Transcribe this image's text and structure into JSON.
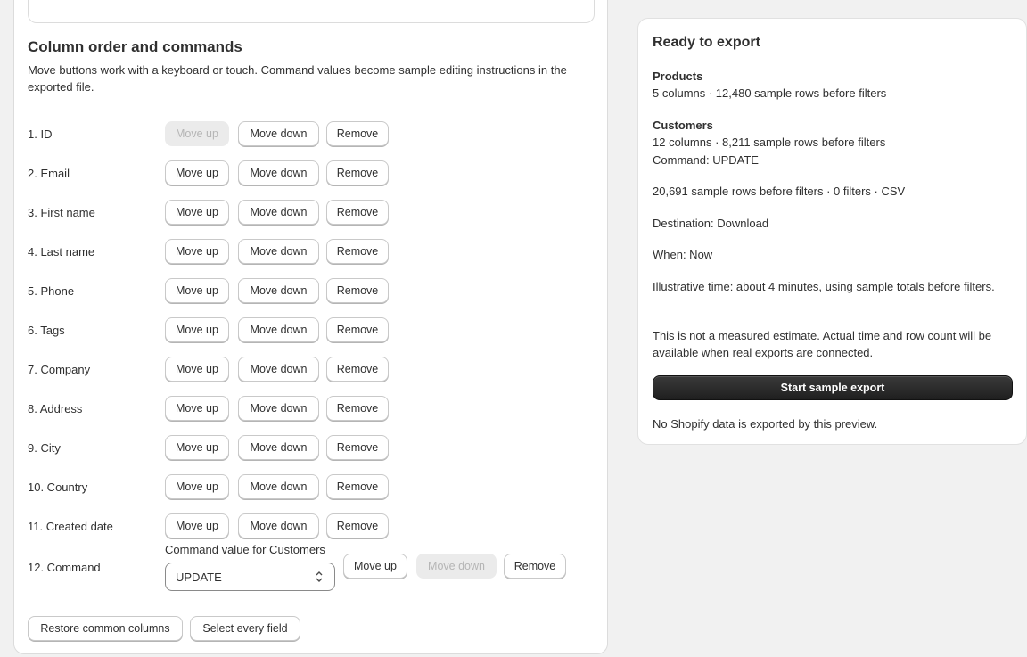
{
  "column_section": {
    "title": "Column order and commands",
    "description": "Move buttons work with a keyboard or touch. Command values become sample editing instructions in the exported file.",
    "move_up_label": "Move up",
    "move_down_label": "Move down",
    "remove_label": "Remove",
    "columns": [
      {
        "label": "1. ID",
        "move_up_disabled": true,
        "move_down_disabled": false
      },
      {
        "label": "2. Email",
        "move_up_disabled": false,
        "move_down_disabled": false
      },
      {
        "label": "3. First name",
        "move_up_disabled": false,
        "move_down_disabled": false
      },
      {
        "label": "4. Last name",
        "move_up_disabled": false,
        "move_down_disabled": false
      },
      {
        "label": "5. Phone",
        "move_up_disabled": false,
        "move_down_disabled": false
      },
      {
        "label": "6. Tags",
        "move_up_disabled": false,
        "move_down_disabled": false
      },
      {
        "label": "7. Company",
        "move_up_disabled": false,
        "move_down_disabled": false
      },
      {
        "label": "8. Address",
        "move_up_disabled": false,
        "move_down_disabled": false
      },
      {
        "label": "9. City",
        "move_up_disabled": false,
        "move_down_disabled": false
      },
      {
        "label": "10. Country",
        "move_up_disabled": false,
        "move_down_disabled": false
      },
      {
        "label": "11. Created date",
        "move_up_disabled": false,
        "move_down_disabled": false
      }
    ],
    "command_row": {
      "label": "12. Command",
      "field_label": "Command value for Customers",
      "selected_value": "UPDATE",
      "move_up_label": "Move up",
      "move_down_label": "Move down",
      "remove_label": "Remove",
      "move_up_disabled": false,
      "move_down_disabled": true
    },
    "restore_label": "Restore common columns",
    "select_every_label": "Select every field"
  },
  "summary": {
    "title": "Ready to export",
    "products_heading": "Products",
    "products_detail": "5 columns · 12,480 sample rows before filters",
    "customers_heading": "Customers",
    "customers_detail": "12 columns · 8,211 sample rows before filters",
    "customers_command": "Command: UPDATE",
    "totals": "20,691 sample rows before filters · 0 filters · CSV",
    "destination": "Destination: Download",
    "when": "When: Now",
    "illustrative_time": "Illustrative time: about 4 minutes, using sample totals before filters.",
    "disclaimer": "This is not a measured estimate. Actual time and row count will be available when real exports are connected.",
    "start_button": "Start sample export",
    "footnote": "No Shopify data is exported by this preview."
  },
  "colors": {
    "primary_button": "#303030",
    "page_background": "#f1f1f1",
    "disabled_button": "#ebebeb"
  },
  "icons": {
    "select_chevron": "chevron-up-down-icon"
  }
}
